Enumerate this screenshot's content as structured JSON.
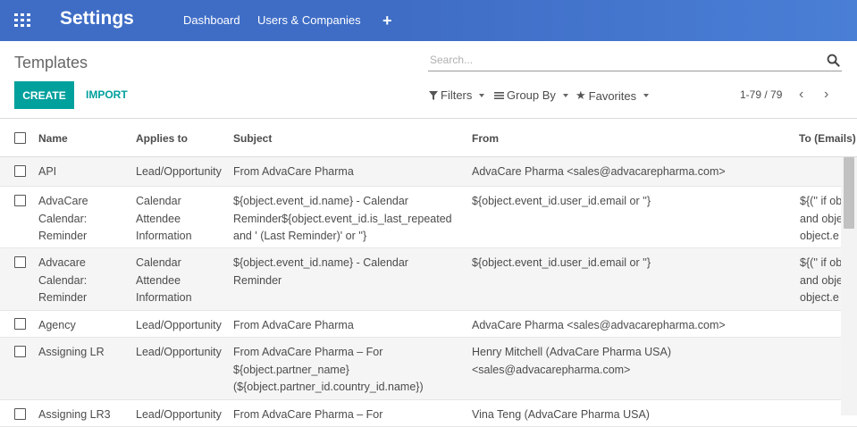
{
  "app": {
    "title": "Settings"
  },
  "nav": {
    "dashboard": "Dashboard",
    "users": "Users & Companies",
    "plus": "+"
  },
  "breadcrumb": "Templates",
  "search": {
    "placeholder": "Search..."
  },
  "toolbar": {
    "create": "CREATE",
    "import": "IMPORT"
  },
  "filters": {
    "filters": "Filters",
    "groupby": "Group By",
    "favorites": "Favorites"
  },
  "pager": {
    "text": "1-79 / 79",
    "prev": "‹",
    "next": "›"
  },
  "table": {
    "headers": {
      "name": "Name",
      "applies": "Applies to",
      "subject": "Subject",
      "from": "From",
      "to": "To (Emails)"
    },
    "rows": [
      {
        "name": "API",
        "applies": "Lead/Opportunity",
        "subject": "From AdvaCare Pharma",
        "from": "AdvaCare Pharma <sales@advacarepharma.com>",
        "to": ""
      },
      {
        "name": "AdvaCare\nCalendar:\nReminder",
        "applies": "Calendar\nAttendee\nInformation",
        "subject": "${object.event_id.name} - Calendar\nReminder${object.event_id.is_last_repeated\nand ' (Last Reminder)' or ''}",
        "from": "${object.event_id.user_id.email or ''}",
        "to": "${('' if ob\nand obje\nobject.e"
      },
      {
        "name": "Advacare\nCalendar:\nReminder",
        "applies": "Calendar\nAttendee\nInformation",
        "subject": "${object.event_id.name} - Calendar\nReminder",
        "from": "${object.event_id.user_id.email or ''}",
        "to": "${('' if ob\nand obje\nobject.e"
      },
      {
        "name": "Agency",
        "applies": "Lead/Opportunity",
        "subject": "From AdvaCare Pharma",
        "from": "AdvaCare Pharma <sales@advacarepharma.com>",
        "to": ""
      },
      {
        "name": "Assigning LR",
        "applies": "Lead/Opportunity",
        "subject": "From AdvaCare Pharma – For\n${object.partner_name}\n(${object.partner_id.country_id.name})",
        "from": "Henry Mitchell (AdvaCare Pharma USA)\n<sales@advacarepharma.com>",
        "to": ""
      },
      {
        "name": "Assigning LR3",
        "applies": "Lead/Opportunity",
        "subject": "From AdvaCare Pharma – For",
        "from": "Vina Teng (AdvaCare Pharma USA)",
        "to": ""
      }
    ]
  },
  "colors": {
    "topbar": "#3f6dc6",
    "accent": "#00a09d"
  }
}
